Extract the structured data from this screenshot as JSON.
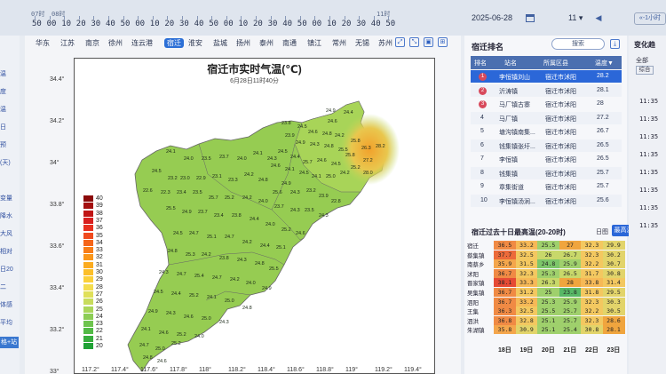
{
  "timeline": {
    "group_labels": [
      "07时",
      "08时",
      "11时"
    ],
    "ticks": [
      "50",
      "00",
      "10",
      "20",
      "30",
      "40",
      "50",
      "00",
      "10",
      "20",
      "30",
      "40",
      "50",
      "00",
      "10",
      "20",
      "30",
      "40",
      "50",
      "00",
      "10",
      "20",
      "30",
      "40",
      "50"
    ],
    "date": "2025-06-28",
    "hour": "11",
    "nav_left": "◀",
    "nav_right": "«",
    "nav_text": "-1小时"
  },
  "left_strip": {
    "items": [
      "温",
      "度",
      "温",
      "日",
      "预",
      "(天)",
      "",
      "变量",
      "降水",
      "大风",
      "相对",
      "日20",
      "二",
      "体感",
      "平均"
    ],
    "button": "格+站"
  },
  "city_tabs": [
    "华东",
    "江苏",
    "南京",
    "徐州",
    "连云港",
    "宿迁",
    "淮安",
    "盐城",
    "扬州",
    "泰州",
    "南通",
    "镇江",
    "常州",
    "无锡",
    "苏州"
  ],
  "active_tab": "宿迁",
  "map": {
    "title": "宿迁市实时气温(℃)",
    "subtitle": "6月28日11时40分",
    "lat_labels": [
      "34.4°",
      "34.2°",
      "34°",
      "33.8°",
      "33.6°",
      "33.4°",
      "33.2°",
      "33°"
    ],
    "lon_labels": [
      "117.2°",
      "117.4°",
      "117.6°",
      "117.8°",
      "118°",
      "118.2°",
      "118.4°",
      "118.6°",
      "118.8°",
      "119°",
      "119.2°",
      "119.4°"
    ],
    "legend": [
      "40",
      "39",
      "38",
      "37",
      "36",
      "35",
      "34",
      "33",
      "32",
      "31",
      "30",
      "29",
      "28",
      "27",
      "26",
      "25",
      "24",
      "23",
      "22",
      "21",
      "20"
    ],
    "legend_colors": [
      "#8b0a0a",
      "#a40f0f",
      "#c01515",
      "#d81f1f",
      "#e83020",
      "#f04a1e",
      "#f5651a",
      "#f87d18",
      "#fa961a",
      "#fbab1f",
      "#fcbf2a",
      "#fbd03a",
      "#f4dd4e",
      "#e0e05a",
      "#c8dc5c",
      "#aad65a",
      "#8ccd55",
      "#6ec44e",
      "#52ba46",
      "#38ae3e",
      "#20a236"
    ],
    "stations": [
      "24.9",
      "24.4",
      "24.6",
      "23.8",
      "24.5",
      "24.6",
      "24.8",
      "24.2",
      "25.8",
      "23.9",
      "24.9",
      "24.3",
      "24.8",
      "25.5",
      "25.8",
      "24.5",
      "24.4",
      "25.7",
      "24.6",
      "24.5",
      "24.6",
      "24.1",
      "24.5",
      "24.1",
      "25.0",
      "24.2",
      "25.2",
      "26.3",
      "27.2",
      "28.2",
      "24.1",
      "24.0",
      "23.5",
      "23.7",
      "24.0",
      "24.1",
      "24.3",
      "24.9",
      "28.0",
      "24.5",
      "23.2",
      "23.0",
      "22.9",
      "23.1",
      "23.3",
      "24.2",
      "24.8",
      "25.6",
      "24.3",
      "23.2",
      "23.9",
      "22.8",
      "22.6",
      "22.3",
      "23.4",
      "23.5",
      "25.7",
      "25.2",
      "24.2",
      "24.0",
      "23.7",
      "24.3",
      "23.5",
      "24.3",
      "25.5",
      "24.9",
      "23.7",
      "23.4",
      "23.8",
      "24.4",
      "24.0",
      "25.2",
      "24.6",
      "24.5",
      "24.7",
      "25.1",
      "24.7",
      "24.2",
      "24.4",
      "25.1",
      "24.8",
      "25.3",
      "24.2",
      "23.8",
      "24.3",
      "24.8",
      "25.5",
      "24.3",
      "24.7",
      "25.4",
      "24.7",
      "24.2",
      "24.0",
      "24.9",
      "24.5",
      "24.4",
      "25.2",
      "24.1",
      "25.0",
      "24.8",
      "24.9",
      "24.3",
      "24.6",
      "25.0",
      "24.3",
      "24.1",
      "24.6",
      "25.2",
      "24.0",
      "24.7",
      "25.0",
      "25.2",
      "24.8",
      "24.6",
      "24.9",
      "24.1",
      "24.5",
      "24.6",
      "24.0",
      "24.8",
      "25.1"
    ]
  },
  "rank_panel": {
    "title": "宿迁排名",
    "search_placeholder": "搜索",
    "headers": [
      "排名",
      "站名",
      "所属区县",
      "温度▼"
    ],
    "rows": [
      {
        "rank": "1",
        "station": "李恒镇刘山",
        "county": "宿迁市沭阳",
        "temp": "28.2"
      },
      {
        "rank": "2",
        "station": "沂涛镇",
        "county": "宿迁市沭阳",
        "temp": "28.1"
      },
      {
        "rank": "3",
        "station": "马厂镇古寨",
        "county": "宿迁市沭阳",
        "temp": "28"
      },
      {
        "rank": "4",
        "station": "马厂镇",
        "county": "宿迁市沭阳",
        "temp": "27.2"
      },
      {
        "rank": "5",
        "station": "塘沟镇南集...",
        "county": "宿迁市沭阳",
        "temp": "26.7"
      },
      {
        "rank": "6",
        "station": "钱集镇张圩...",
        "county": "宿迁市沭阳",
        "temp": "26.5"
      },
      {
        "rank": "7",
        "station": "李恒镇",
        "county": "宿迁市沭阳",
        "temp": "26.5"
      },
      {
        "rank": "8",
        "station": "钱集镇",
        "county": "宿迁市沭阳",
        "temp": "25.7"
      },
      {
        "rank": "9",
        "station": "章集街道",
        "county": "宿迁市沭阳",
        "temp": "25.7"
      },
      {
        "rank": "10",
        "station": "李恒镇汤涧...",
        "county": "宿迁市沭阳",
        "temp": "25.6"
      }
    ]
  },
  "history": {
    "title": "宿迁过去十日最高温(20-20时)",
    "tab_day": "日图",
    "tab_max": "最高温",
    "stations": [
      "宿迁",
      "蔡集镇",
      "南蔡乡",
      "沭阳",
      "晋家镇",
      "吴集镇",
      "泗阳",
      "王集",
      "泗洪",
      "朱湖镇"
    ],
    "dates": [
      "18日",
      "19日",
      "20日",
      "21日",
      "22日",
      "23日"
    ],
    "values": [
      [
        "36.5",
        "33.2",
        "25.5",
        "27",
        "32.3",
        "29.9"
      ],
      [
        "37.7",
        "32.5",
        "26",
        "26.7",
        "32.3",
        "30.2"
      ],
      [
        "35.9",
        "31.5",
        "24.8",
        "25.9",
        "32.2",
        "30.7"
      ],
      [
        "36.7",
        "32.3",
        "25.3",
        "26.5",
        "31.7",
        "30.8"
      ],
      [
        "38.1",
        "33.3",
        "26.3",
        "28",
        "33.8",
        "31.4"
      ],
      [
        "36.7",
        "31.2",
        "25",
        "23.8",
        "31.8",
        "29.5"
      ],
      [
        "36.7",
        "33.2",
        "25.3",
        "25.9",
        "32.3",
        "30.3"
      ],
      [
        "36.3",
        "32.5",
        "25.5",
        "25.7",
        "32.2",
        "30.5"
      ],
      [
        "36.8",
        "32.8",
        "25.1",
        "25.7",
        "32.3",
        "28.6"
      ],
      [
        "35.8",
        "30.9",
        "25.1",
        "25.4",
        "30.8",
        "28.1"
      ]
    ]
  },
  "far_panel": {
    "title": "变化趋",
    "all_label": "全部",
    "select_label": "综合",
    "times": [
      "11:35",
      "11:35",
      "11:35",
      "11:35",
      "11:35",
      "11:35",
      "11:35",
      "11:35"
    ]
  }
}
